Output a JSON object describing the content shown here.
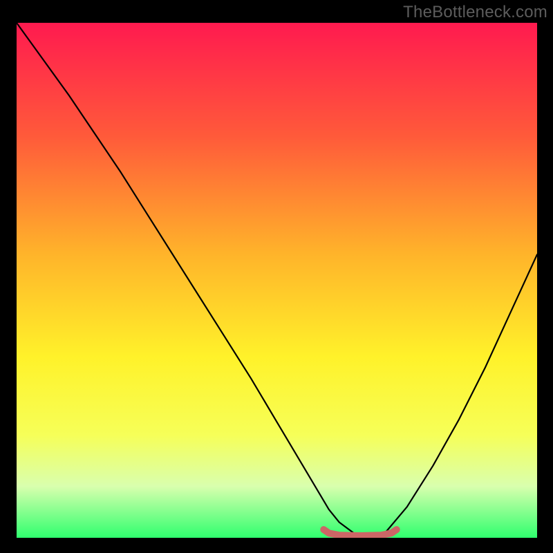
{
  "attribution": "TheBottleneck.com",
  "chart_data": {
    "type": "line",
    "title": "",
    "xlabel": "",
    "ylabel": "",
    "xlim": [
      0,
      100
    ],
    "ylim": [
      0,
      100
    ],
    "grid": false,
    "series": [
      {
        "name": "curve",
        "color": "#000000",
        "x": [
          0,
          5,
          10,
          15,
          20,
          25,
          30,
          35,
          40,
          45,
          50,
          55,
          60,
          62,
          66,
          70,
          75,
          80,
          85,
          90,
          95,
          100
        ],
        "y": [
          100,
          93,
          86,
          78.5,
          71,
          63,
          55,
          47,
          39,
          31,
          22.5,
          14,
          5.5,
          3,
          0,
          0,
          6,
          14,
          23,
          33,
          44,
          55
        ]
      },
      {
        "name": "optimal-band",
        "color": "#cc6666",
        "x": [
          59,
          60,
          62,
          66,
          70,
          72,
          73
        ],
        "y": [
          1.6,
          0.9,
          0.5,
          0.4,
          0.5,
          0.9,
          1.6
        ]
      }
    ]
  }
}
